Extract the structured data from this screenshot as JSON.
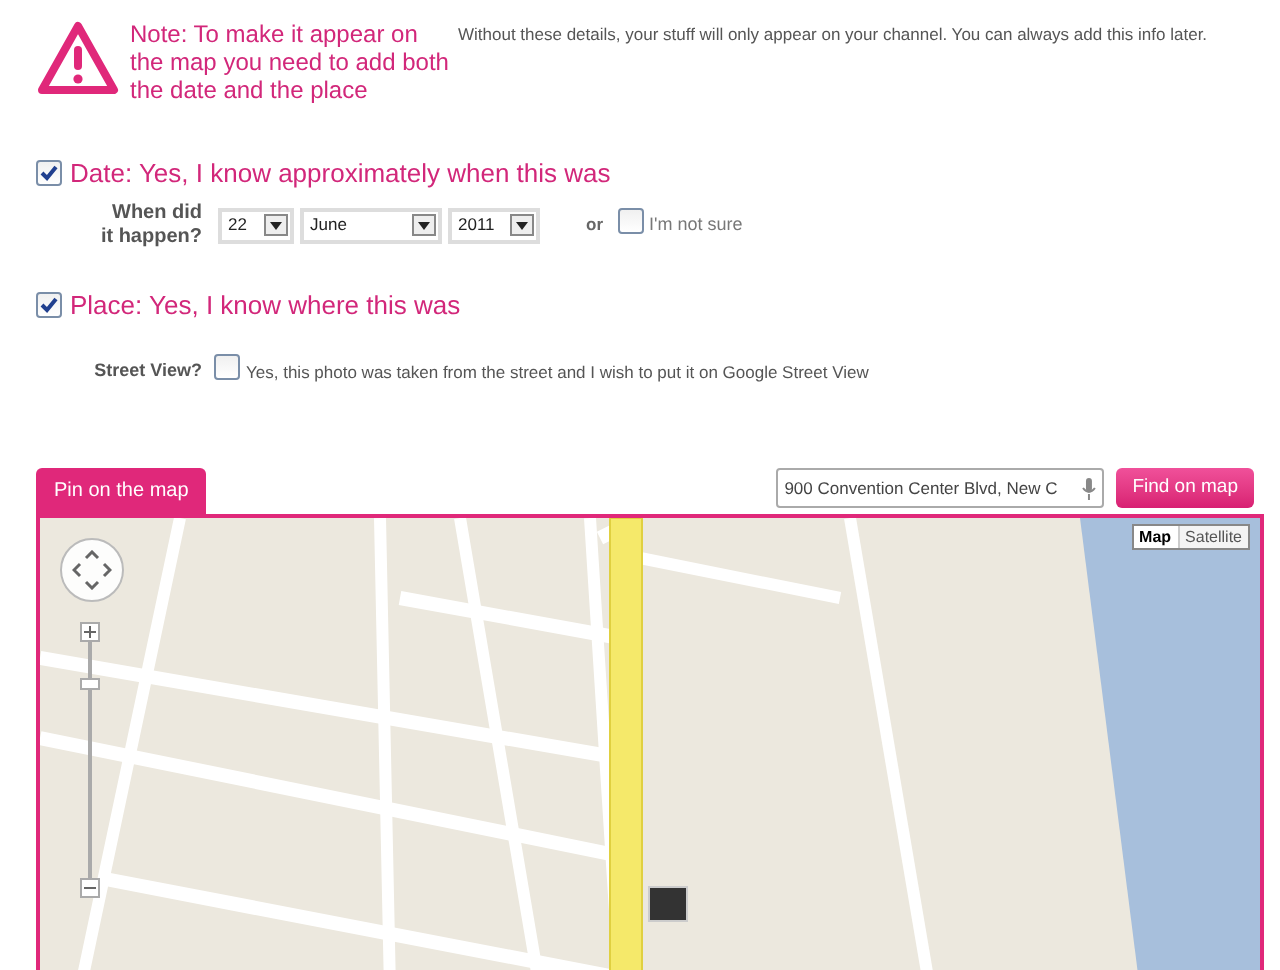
{
  "note": {
    "title": "Note: To make it appear on the map you need to add both the date and the place",
    "text": "Without these details, your stuff will only appear on your channel. You can always add this info later."
  },
  "date": {
    "label": "Date: Yes, I know approximately when this was",
    "checked": true,
    "question": "When did it happen?",
    "selects": [
      {
        "value": "22"
      },
      {
        "value": "June"
      },
      {
        "value": "2011"
      }
    ],
    "or": "or",
    "not_sure": {
      "label": "I'm not sure",
      "checked": false
    }
  },
  "place": {
    "label": "Place: Yes, I know where this was",
    "checked": true
  },
  "street_view": {
    "question": "Street View?",
    "label": "Yes, this photo was taken from the street and I wish to put it on Google Street View",
    "checked": false
  },
  "map_panel": {
    "tab": {
      "label": "Pin on the map",
      "selected": true
    },
    "search": {
      "value": "900 Convention Center Blvd, New C"
    },
    "find_button": "Find on map",
    "map_types": [
      {
        "label": "Map",
        "selected": true
      },
      {
        "label": "Satellite",
        "selected": false
      }
    ]
  }
}
